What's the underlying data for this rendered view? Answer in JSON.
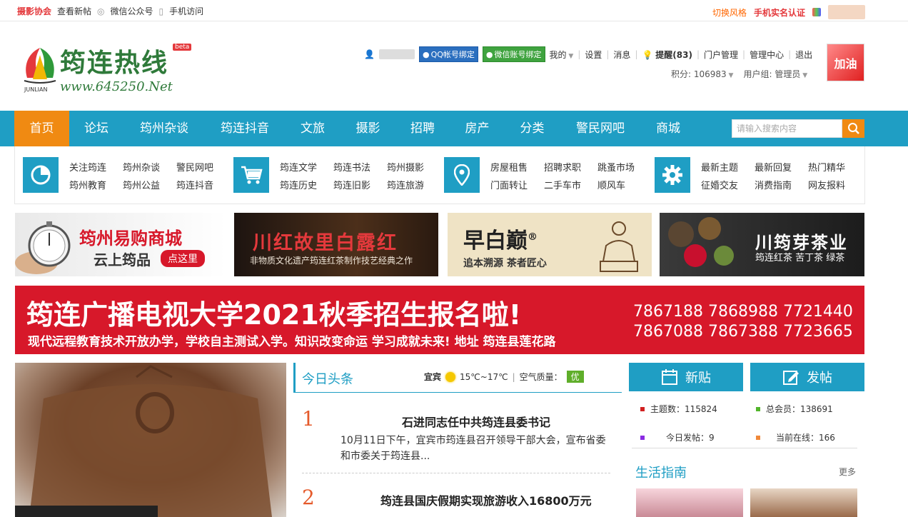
{
  "topbar": {
    "left": [
      "摄影协会",
      "查看新帖",
      "微信公众号",
      "手机访问"
    ],
    "switch_style": "切换风格",
    "realname": "手机实名认证"
  },
  "logo": {
    "title": "筠连热线",
    "beta": "beta",
    "url": "www.645250.Net",
    "sub": "JUNLIAN"
  },
  "user": {
    "qq_bind": "QQ帐号绑定",
    "wx_bind": "微信账号绑定",
    "my": "我的",
    "settings": "设置",
    "messages": "消息",
    "remind_label": "提醒",
    "remind_count": "(83)",
    "portal": "门户管理",
    "admin": "管理中心",
    "logout": "退出",
    "points": "积分: 106983",
    "group": "用户组: 管理员",
    "avatar_text": "加油"
  },
  "nav": {
    "items": [
      "首页",
      "论坛",
      "筠州杂谈",
      "筠连抖音",
      "文旅",
      "摄影",
      "招聘",
      "房产",
      "分类",
      "警民网吧",
      "商城"
    ],
    "search_placeholder": "请输入搜索内容"
  },
  "subnav": {
    "groups": [
      {
        "icon": "pie-chart-icon",
        "links": [
          "关注筠连",
          "筠州杂谈",
          "警民网吧",
          "筠州教育",
          "筠州公益",
          "筠连抖音"
        ]
      },
      {
        "icon": "cart-icon",
        "links": [
          "筠连文学",
          "筠连书法",
          "筠州摄影",
          "筠连历史",
          "筠连旧影",
          "筠连旅游"
        ]
      },
      {
        "icon": "location-pin-icon",
        "links": [
          "房屋租售",
          "招聘求职",
          "跳蚤市场",
          "门面转让",
          "二手车市",
          "顺风车"
        ]
      },
      {
        "icon": "gear-icon",
        "links": [
          "最新主题",
          "最新回复",
          "热门精华",
          "征婚交友",
          "消费指南",
          "网友报料"
        ]
      }
    ]
  },
  "banners": {
    "b1_title": "筠州易购商城",
    "b1_sub": "云上筠品",
    "b1_btn": "点这里",
    "b2_title": "川红故里白露红",
    "b2_sub": "非物质文化遗产筠连红茶制作技艺经典之作",
    "b3_title": "早白巅",
    "b3_reg": "®",
    "b3_sub": "追本溯源  茶者匠心",
    "b4_title": "川筠芽茶业",
    "b4_sub": "筠连红茶  苦丁茶  绿茶",
    "big_title": "筠连广播电视大学2021秋季招生报名啦!",
    "big_sub": "现代远程教育技术开放办学，学校自主测试入学。知识改变命运  学习成就未来! 地址 筠连县莲花路",
    "big_phone1": "7867188 7868988 7721440",
    "big_phone2": "7867088 7867388 7723665"
  },
  "today": {
    "title": "今日头条",
    "city": "宜宾",
    "temp": "15℃~17℃",
    "aq_label": "空气质量：",
    "aq_value": "优",
    "news": [
      {
        "num": "1",
        "title": "石进同志任中共筠连县委书记",
        "desc": "10月11日下午，宜宾市筠连县召开领导干部大会，宣布省委和市委关于筠连县..."
      },
      {
        "num": "2",
        "title": "筠连县国庆假期实现旅游收入16800万元",
        "desc": ""
      }
    ]
  },
  "right": {
    "tab_new": "新贴",
    "tab_post": "发帖",
    "stats": [
      {
        "label": "主题数：115824",
        "color": "#d12020"
      },
      {
        "label": "总会员：138691",
        "color": "#52b52b"
      },
      {
        "label": "今日发帖：9",
        "color": "#8a2be2"
      },
      {
        "label": "当前在线：166",
        "color": "#f0883a"
      }
    ],
    "life_title": "生活指南",
    "more": "更多"
  }
}
